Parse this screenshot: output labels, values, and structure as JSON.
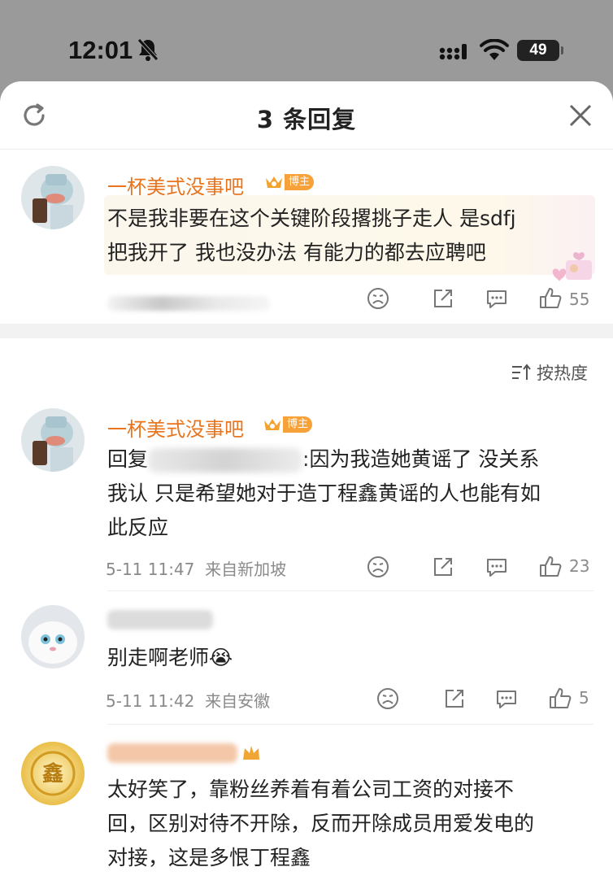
{
  "status_bar": {
    "time": "12:01",
    "battery": "49"
  },
  "header": {
    "title": "3 条回复"
  },
  "root_comment": {
    "username": "一杯美式没事吧",
    "badge": "博主",
    "text_line1": "不是我非要在这个关键阶段撂挑子走人 是sdfj",
    "text_line2": "把我开了 我也没办法 有能力的都去应聘吧",
    "likes": "55"
  },
  "sort": {
    "label": "按热度"
  },
  "replies": [
    {
      "username": "一杯美式没事吧",
      "badge": "博主",
      "reply_prefix": "回复",
      "text_after": ":因为我造她黄谣了 没关系",
      "text_line2": "我认 只是希望她对于造丁程鑫黄谣的人也能有如",
      "text_line3": "此反应",
      "time": "5-11 11:47",
      "location": "来自新加坡",
      "likes": "23"
    },
    {
      "text": "别走啊老师",
      "emoji": "😭",
      "time": "5-11 11:42",
      "location": "来自安徽",
      "likes": "5"
    },
    {
      "text_line1": "太好笑了，靠粉丝养着有着公司工资的对接不",
      "text_line2": "回，区别对待不开除，反而开除成员用爱发电的",
      "text_line3": "对接，这是多恨丁程鑫",
      "avatar_text": "鑫"
    }
  ],
  "colors": {
    "username": "#e8741e",
    "badge": "#f6a13a",
    "meta": "#8a8a8a"
  },
  "icons": [
    "refresh-icon",
    "close-icon",
    "dislike-icon",
    "share-icon",
    "comment-icon",
    "like-icon",
    "sort-icon"
  ]
}
